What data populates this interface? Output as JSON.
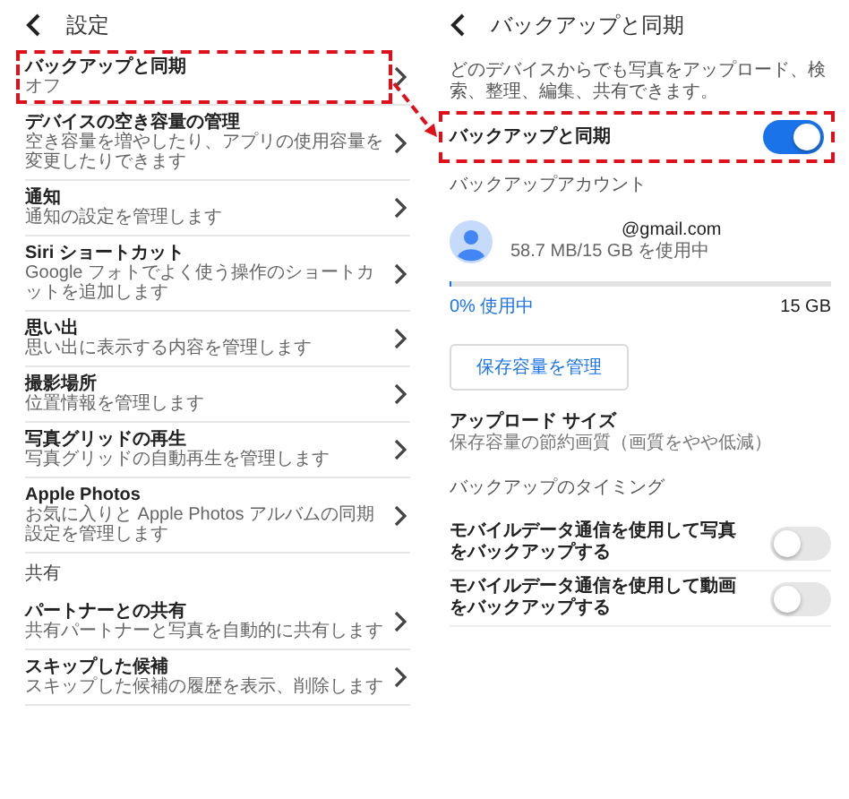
{
  "settings": {
    "title": "設定",
    "items": [
      {
        "kind": "item",
        "title": "バックアップと同期",
        "subtitle": "オフ",
        "highlighted": true
      },
      {
        "kind": "item",
        "title": "デバイスの空き容量の管理",
        "subtitle": "空き容量を増やしたり、アプリの使用容量を変更したりできます",
        "highlighted": false
      },
      {
        "kind": "item",
        "title": "通知",
        "subtitle": "通知の設定を管理します",
        "highlighted": false
      },
      {
        "kind": "item",
        "title": "Siri ショートカット",
        "subtitle": "Google フォトでよく使う操作のショートカットを追加します",
        "highlighted": false
      },
      {
        "kind": "item",
        "title": "思い出",
        "subtitle": "思い出に表示する内容を管理します",
        "highlighted": false
      },
      {
        "kind": "item",
        "title": "撮影場所",
        "subtitle": "位置情報を管理します",
        "highlighted": false
      },
      {
        "kind": "item",
        "title": "写真グリッドの再生",
        "subtitle": "写真グリッドの自動再生を管理します",
        "highlighted": false
      },
      {
        "kind": "item",
        "title": "Apple Photos",
        "subtitle": "お気に入りと Apple Photos アルバムの同期設定を管理します",
        "highlighted": false
      },
      {
        "kind": "section",
        "title": "共有"
      },
      {
        "kind": "item",
        "title": "パートナーとの共有",
        "subtitle": "共有パートナーと写真を自動的に共有します",
        "highlighted": false
      },
      {
        "kind": "item",
        "title": "スキップした候補",
        "subtitle": "スキップした候補の履歴を表示、削除します",
        "highlighted": false
      }
    ]
  },
  "backup": {
    "title": "バックアップと同期",
    "description": "どのデバイスからでも写真をアップロード、検索、整理、編集、共有できます。",
    "sync_toggle": {
      "label": "バックアップと同期",
      "on": true,
      "highlighted": true
    },
    "account_section": "バックアップアカウント",
    "account": {
      "email": "@gmail.com",
      "usage": "58.7 MB/15 GB を使用中"
    },
    "storage": {
      "level": 0.004,
      "used": "0% 使用中",
      "total": "15 GB"
    },
    "manage_button": "保存容量を管理",
    "upload_size": {
      "title": "アップロード サイズ",
      "subtitle": "保存容量の節約画質（画質をやや低減）"
    },
    "timing_section": "バックアップのタイミング",
    "timing_toggles": [
      {
        "label": "モバイルデータ通信を使用して写真をバックアップする",
        "on": false
      },
      {
        "label": "モバイルデータ通信を使用して動画をバックアップする",
        "on": false
      }
    ]
  }
}
